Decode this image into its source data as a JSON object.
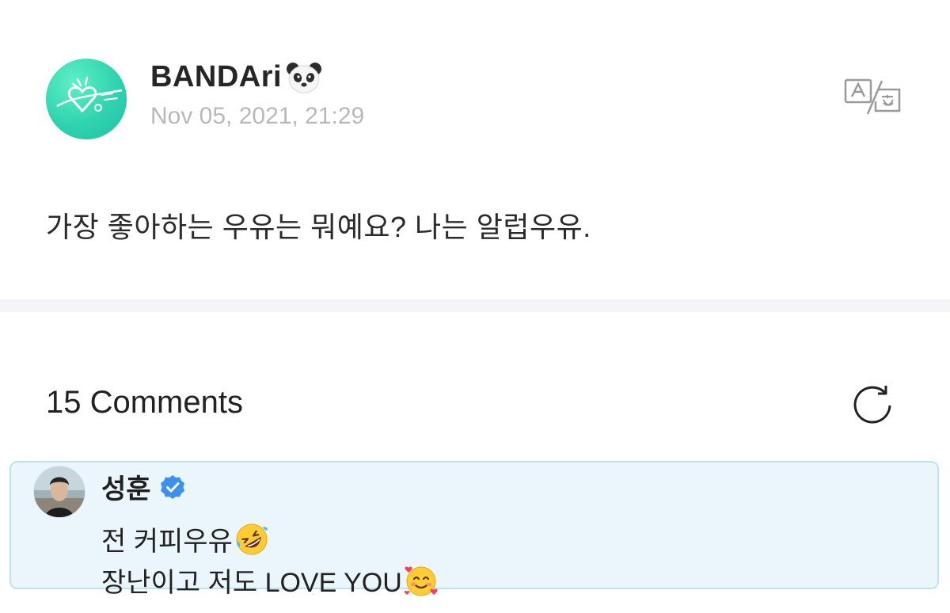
{
  "post": {
    "author": "BANDAri",
    "author_emoji": "panda-face-emoji",
    "timestamp": "Nov 05, 2021, 21:29",
    "body": "가장 좋아하는 우유는 뭐예요? 나는 알럽우유.",
    "translate_icon": "translate-icon"
  },
  "comments": {
    "title": "15 Comments",
    "refresh_icon": "refresh-icon",
    "items": [
      {
        "name": "성훈",
        "verified": true,
        "line1": "전 커피우유",
        "line1_emoji": "rolling-on-floor-laughing-emoji",
        "line2": "장난이고 저도 LOVE YOU",
        "line2_emoji": "smiling-face-with-hearts-emoji"
      }
    ]
  },
  "colors": {
    "accent_teal": "#2fd3b0",
    "verified_blue": "#3d8ff0",
    "comment_bg": "#eaf6fc",
    "comment_border": "#bde3f1",
    "timestamp_gray": "#b8b8b8"
  }
}
